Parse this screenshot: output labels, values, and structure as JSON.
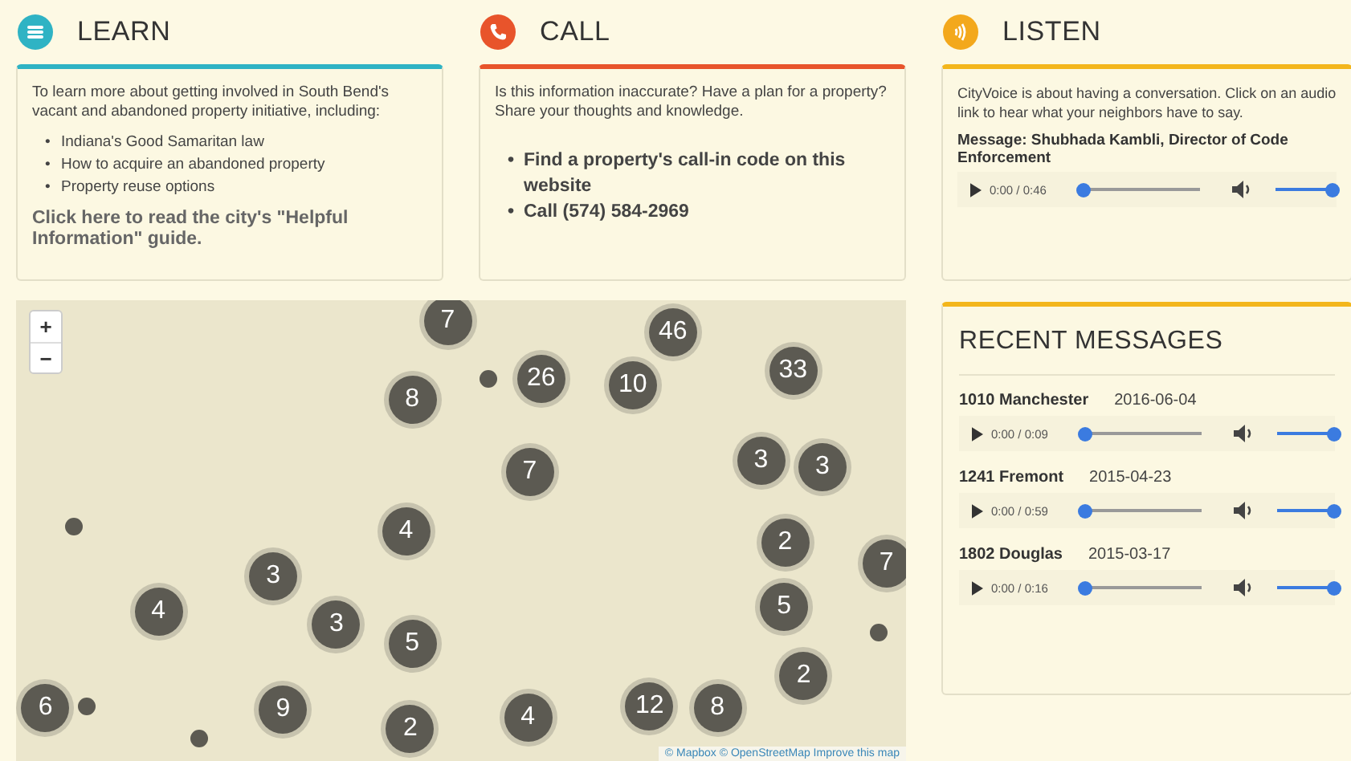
{
  "learn": {
    "title": "LEARN",
    "intro": "To learn more about getting involved in South Bend's vacant and abandoned property initiative, including:",
    "items": [
      {
        "marker": "•",
        "text": "Indiana's Good Samaritan law"
      },
      {
        "marker": "•",
        "text": "How to acquire an abandoned property"
      },
      {
        "marker": "•",
        "text": "Property reuse options"
      }
    ],
    "link": "Click here to read the city's \"Helpful Information\" guide."
  },
  "call": {
    "title": "CALL",
    "intro": "Is this information inaccurate? Have a plan for a property? Share your thoughts and knowledge.",
    "items": [
      {
        "marker": "•",
        "text": "Find a property's call-in code on this website"
      },
      {
        "marker": "•",
        "text": "Call (574) 584-2969"
      }
    ]
  },
  "listen": {
    "title": "LISTEN",
    "intro": "CityVoice is about having a conversation. Click on an audio link to hear what your neighbors have to say.",
    "message_title": "Message: Shubhada Kambli, Director of Code Enforcement",
    "player": {
      "time": "0:00 / 0:46",
      "level": 0,
      "volume": {
        "level": 1
      }
    }
  },
  "map": {
    "zoom_in": "+",
    "zoom_out": "−",
    "attribution": "© Mapbox © OpenStreetMap Improve this map",
    "clusters": [
      {
        "count": "7"
      },
      {
        "count": "46"
      },
      {
        "count": "26"
      },
      {
        "count": "10"
      },
      {
        "count": "33"
      },
      {
        "count": "8"
      },
      {
        "count": "7"
      },
      {
        "count": "3"
      },
      {
        "count": "3"
      },
      {
        "count": "4"
      },
      {
        "count": "2"
      },
      {
        "count": "3"
      },
      {
        "count": "7"
      },
      {
        "count": "4"
      },
      {
        "count": "3"
      },
      {
        "count": "5"
      },
      {
        "count": "5"
      },
      {
        "count": "2"
      },
      {
        "count": "6"
      },
      {
        "count": "9"
      },
      {
        "count": "2"
      },
      {
        "count": "4"
      },
      {
        "count": "12"
      },
      {
        "count": "8"
      }
    ]
  },
  "recent": {
    "title": "RECENT MESSAGES",
    "messages": [
      {
        "address": "1010 Manchester",
        "date": "2016-06-04",
        "player": {
          "time": "0:00 / 0:09",
          "level": 0,
          "volume": {
            "level": 1
          }
        }
      },
      {
        "address": "1241 Fremont",
        "date": "2015-04-23",
        "player": {
          "time": "0:00 / 0:59",
          "level": 0,
          "volume": {
            "level": 1
          }
        }
      },
      {
        "address": "1802 Douglas",
        "date": "2015-03-17",
        "player": {
          "time": "0:00 / 0:16",
          "level": 0,
          "volume": {
            "level": 1
          }
        }
      }
    ]
  }
}
